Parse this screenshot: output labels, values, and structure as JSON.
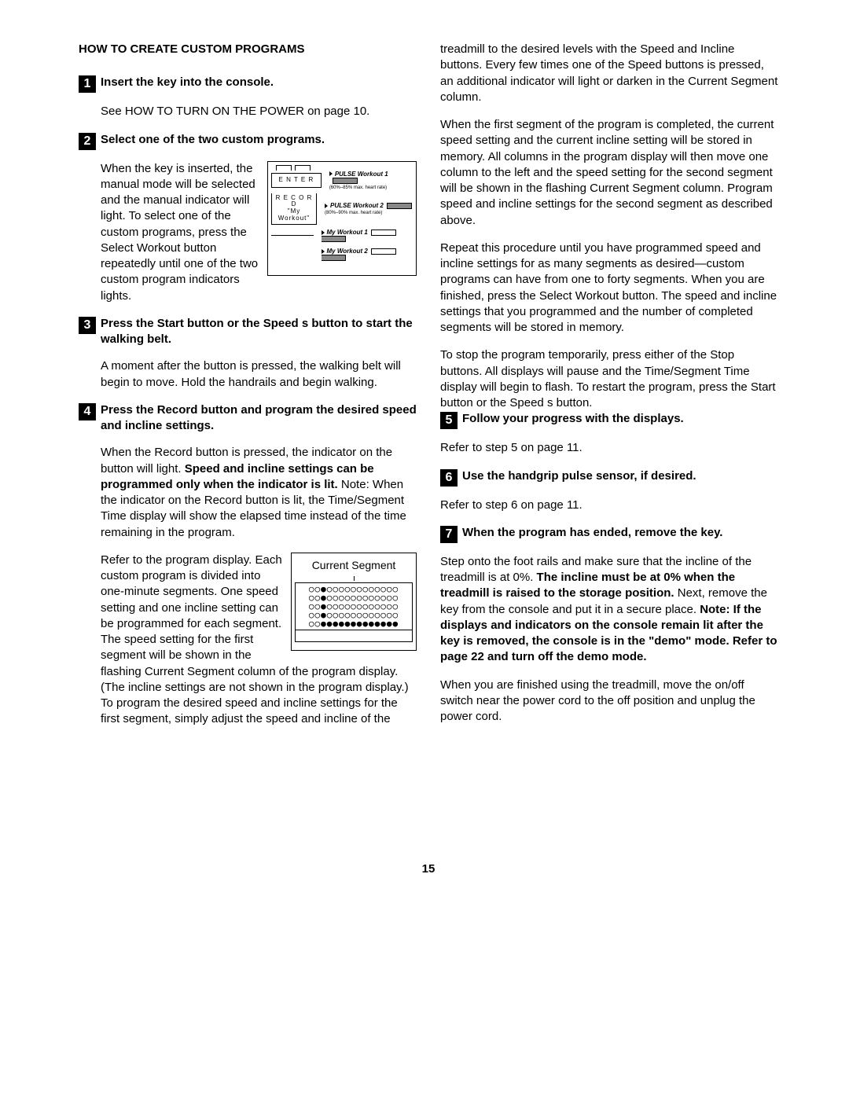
{
  "sectionTitle": "HOW TO CREATE CUSTOM PROGRAMS",
  "pageNumber": "15",
  "steps": {
    "s1": {
      "num": "1",
      "title": "Insert the key into the console.",
      "p1": "See HOW TO TURN ON THE POWER on page 10."
    },
    "s2": {
      "num": "2",
      "title": "Select one of the two custom programs.",
      "p1": "When the key is inserted, the manual mode will be selected and the manual indicator will light. To select one of the custom programs, press the Select Workout button repeatedly until one of the two custom program indicators lights."
    },
    "fig1": {
      "enter": "E N T E R",
      "record1": "R E C O R D",
      "record2": "\"My Workout\"",
      "pw1a": "PULSE Workout 1",
      "pw1b": "(60%–85% max. heart rate)",
      "pw2a": "PULSE Workout 2",
      "pw2b": "(80%–90% max. heart rate)",
      "mw1": "My Workout 1",
      "mw2": "My Workout 2"
    },
    "s3": {
      "num": "3",
      "title": "Press the Start button or the Speed s button to start the walking belt.",
      "p1": "A moment after the button is pressed, the walking belt will begin to move. Hold the handrails and begin walking."
    },
    "s4": {
      "num": "4",
      "title": "Press the Record button and program the desired speed and incline settings.",
      "p1a": "When the Record button is pressed, the indicator on the button will light. ",
      "p1b": "Speed and incline settings can be programmed only when the indicator is lit.",
      "p1c": " Note: When the indicator on the Record button is lit, the Time/Segment Time display will show the elapsed time instead of the time remaining in the program.",
      "p2": "Refer to the program display. Each custom program is divided into one-minute segments. One speed setting and one incline setting can be programmed for each segment. The speed setting for the first segment will be shown in the flashing Current Segment column of the program display. (The incline settings are not shown in the program display.) To program the desired speed and incline settings for the first segment, simply adjust the speed and incline of the",
      "fig2caption": "Current Segment",
      "p3": "treadmill to the desired levels with the Speed and Incline buttons. Every few times one of the Speed buttons is pressed, an additional indicator will light or darken in the Current Segment column.",
      "p4": "When the first segment of the program is completed, the current speed setting and the current incline setting will be stored in memory. All columns in the program display will then move one column to the left and the speed setting for the second segment will be shown in the flashing Current Segment column. Program speed and incline settings for the second segment as described above.",
      "p5": "Repeat this procedure until you have programmed speed and incline settings for as many segments as desired—custom programs can have from one to forty segments. When you are finished, press the Select Workout button. The speed and incline settings that you programmed and the number of completed segments will be stored in memory.",
      "p6": "To stop the program temporarily, press either of the Stop buttons. All displays will pause and the Time/Segment Time display will begin to flash. To restart the program, press the Start button or the Speed s button."
    },
    "s5": {
      "num": "5",
      "title": "Follow your progress with the displays.",
      "p1": "Refer to step 5 on page 11."
    },
    "s6": {
      "num": "6",
      "title": "Use the handgrip pulse sensor, if desired.",
      "p1": "Refer to step 6 on page 11."
    },
    "s7": {
      "num": "7",
      "title": "When the program has ended, remove the key.",
      "p1a": "Step onto the foot rails and make sure that the incline of the treadmill is at 0%. ",
      "p1b": "The incline must be at 0% when the treadmill is raised to the storage position.",
      "p1c": " Next, remove the key from the console and put it in a secure place. ",
      "p1d": "Note: If the displays and indicators on the console remain lit after the key is removed, the console is in the \"demo\" mode. Refer to page 22 and turn off the demo mode.",
      "p2": "When you are finished using the treadmill, move the on/off switch near the power cord to the off position and unplug the power cord."
    }
  }
}
